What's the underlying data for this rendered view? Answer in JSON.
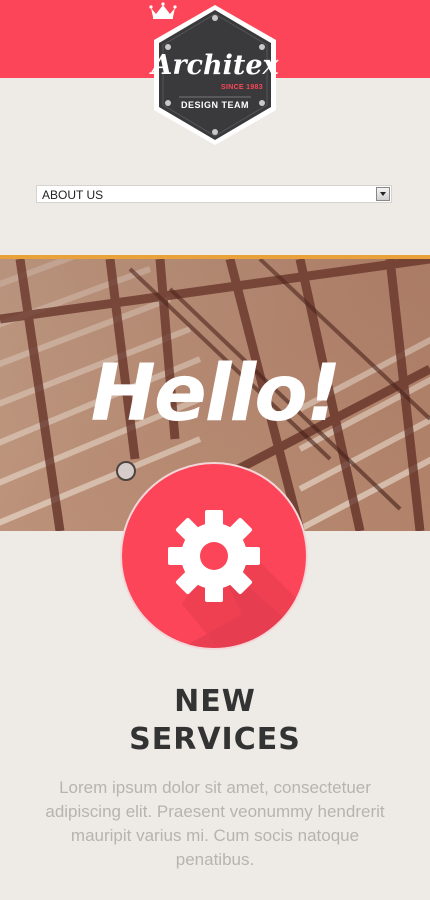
{
  "brand": {
    "name": "Architex",
    "since": "SINCE 1983",
    "tagline": "DESIGN TEAM",
    "icon": "crown-icon"
  },
  "nav": {
    "selected": "ABOUT US"
  },
  "hero": {
    "title": "Hello!"
  },
  "feature": {
    "icon": "gear-icon",
    "title_line1": "NEW",
    "title_line2": "SERVICES",
    "text": "Lorem ipsum dolor sit amet, consectetuer adipiscing elit. Praesent veonummy hendrerit mauripit varius mi. Cum socis natoque penatibus."
  },
  "colors": {
    "accent": "#fc4558",
    "badge": "#3a3a3c",
    "rule": "#e9a13a",
    "background": "#eeebe7"
  }
}
